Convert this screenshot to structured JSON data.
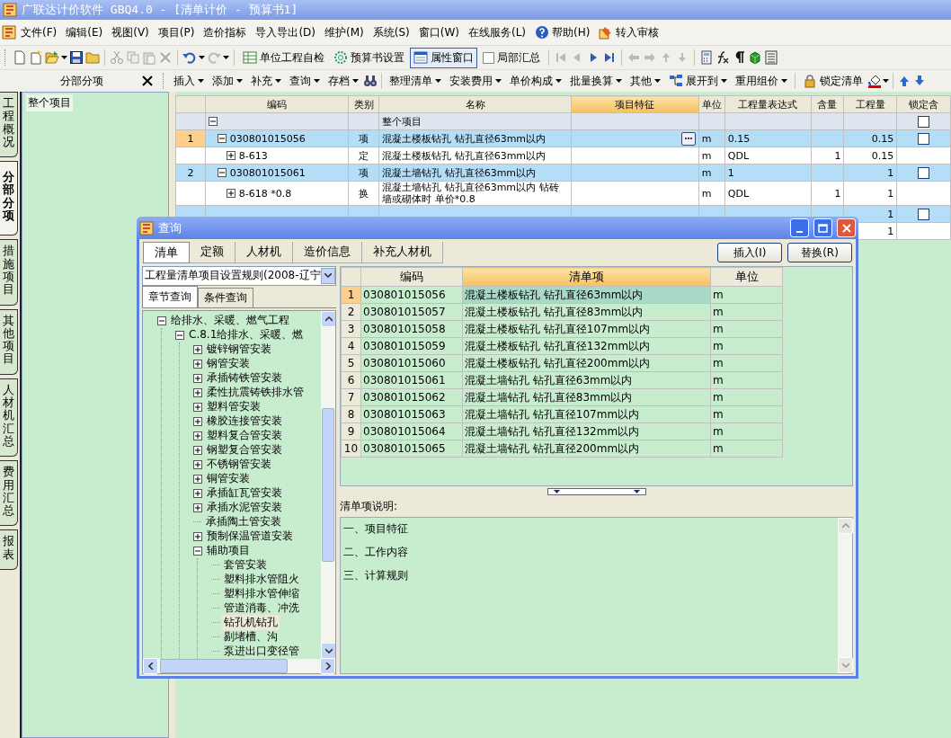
{
  "window": {
    "title": "广联达计价软件 GBQ4.0 - [清单计价 - 预算书1]"
  },
  "menu": [
    {
      "label": "文件(F)"
    },
    {
      "label": "编辑(E)"
    },
    {
      "label": "视图(V)"
    },
    {
      "label": "项目(P)"
    },
    {
      "label": "造价指标"
    },
    {
      "label": "导入导出(D)"
    },
    {
      "label": "维护(M)"
    },
    {
      "label": "系统(S)"
    },
    {
      "label": "窗口(W)"
    },
    {
      "label": "在线服务(L)"
    },
    {
      "label": "帮助(H)"
    },
    {
      "label": "转入审核"
    }
  ],
  "toolbar": [
    {
      "label": "单位工程自检",
      "kind": "button"
    },
    {
      "label": "预算书设置",
      "kind": "button"
    },
    {
      "label": "属性窗口",
      "kind": "toggle",
      "pressed": true
    },
    {
      "label": "局部汇总",
      "kind": "check",
      "checked": false
    }
  ],
  "side_tabs": [
    {
      "label": "工程概况",
      "selected": false
    },
    {
      "label": "分部分项",
      "selected": true
    },
    {
      "label": "措施项目",
      "selected": false
    },
    {
      "label": "其他项目",
      "selected": false
    },
    {
      "label": "人材机汇总",
      "selected": false
    },
    {
      "label": "费用汇总",
      "selected": false
    },
    {
      "label": "报表",
      "selected": false
    }
  ],
  "left_panel": {
    "title": "分部分项",
    "items": [
      {
        "label": "整个项目",
        "selected": true
      }
    ]
  },
  "grid_toolbar": [
    {
      "label": "插入",
      "dropdown": true
    },
    {
      "label": "添加",
      "dropdown": true
    },
    {
      "label": "补充",
      "dropdown": true
    },
    {
      "label": "查询",
      "dropdown": true
    },
    {
      "label": "存档",
      "dropdown": true
    },
    {
      "label": "整理清单",
      "dropdown": true
    },
    {
      "label": "安装费用",
      "dropdown": true
    },
    {
      "label": "单价构成",
      "dropdown": true
    },
    {
      "label": "批量换算",
      "dropdown": true
    },
    {
      "label": "其他",
      "dropdown": true
    },
    {
      "label": "展开到",
      "dropdown": true
    },
    {
      "label": "重用组价",
      "dropdown": true
    },
    {
      "label": "锁定清单",
      "dropdown": false
    }
  ],
  "table": {
    "columns": [
      {
        "label": "编码",
        "selected": false
      },
      {
        "label": "类别",
        "selected": false
      },
      {
        "label": "名称",
        "selected": false
      },
      {
        "label": "项目特征",
        "selected": true
      },
      {
        "label": "单位",
        "selected": false
      },
      {
        "label": "工程量表达式",
        "selected": false
      },
      {
        "label": "含量",
        "selected": false
      },
      {
        "label": "工程量",
        "selected": false
      },
      {
        "label": "锁定含",
        "selected": false
      }
    ],
    "rows": [
      {
        "kind": "section",
        "name": "整个项目",
        "expanded": true,
        "selected": false,
        "locked": false
      },
      {
        "kind": "bill",
        "seq": "1",
        "code": "030801015056",
        "type": "项",
        "name": "混凝土楼板钻孔 钻孔直径63mm以内",
        "unit": "m",
        "expr": "0.15",
        "qty": "0.15",
        "expanded": true,
        "selected": true,
        "locked": false
      },
      {
        "kind": "norm",
        "code": "8-613",
        "type": "定",
        "name": "混凝土楼板钻孔 钻孔直径63mm以内",
        "unit": "m",
        "expr": "QDL",
        "content": "1",
        "qty": "0.15",
        "expanded": false,
        "selected": false
      },
      {
        "kind": "bill",
        "seq": "2",
        "code": "030801015061",
        "type": "项",
        "name": "混凝土墙钻孔 钻孔直径63mm以内",
        "unit": "m",
        "expr": "1",
        "qty": "1",
        "expanded": true,
        "selected": false,
        "locked": false
      },
      {
        "kind": "norm",
        "code": "8-618 *0.8",
        "type": "换",
        "name": "混凝土墙钻孔 钻孔直径63mm以内 钻砖墙或砌体时 单价*0.8",
        "unit": "m",
        "expr": "QDL",
        "content": "1",
        "qty": "1",
        "expanded": false,
        "selected": false
      },
      {
        "kind": "bill",
        "qty": "1",
        "locked": false
      },
      {
        "kind": "norm",
        "qty": "1"
      }
    ]
  },
  "dialog": {
    "title": "查询",
    "tabs": [
      {
        "label": "清单",
        "selected": true
      },
      {
        "label": "定额",
        "selected": false
      },
      {
        "label": "人材机",
        "selected": false
      },
      {
        "label": "造价信息",
        "selected": false
      },
      {
        "label": "补充人材机",
        "selected": false
      }
    ],
    "buttons": [
      "插入(I)",
      "替换(R)"
    ],
    "rule_select": "工程量清单项目设置规则(2008-辽宁",
    "search_tabs": [
      {
        "label": "章节查询",
        "selected": true
      },
      {
        "label": "条件查询",
        "selected": false
      }
    ],
    "tree": [
      {
        "label": "给排水、采暖、燃气工程",
        "expanded": true,
        "selected": false,
        "children": [
          {
            "label": "C.8.1给排水、采暖、燃",
            "expanded": true,
            "selected": false,
            "children": [
              {
                "label": "镀锌钢管安装",
                "expanded": false,
                "selected": false
              },
              {
                "label": "钢管安装",
                "expanded": false,
                "selected": false
              },
              {
                "label": "承插铸铁管安装",
                "expanded": false,
                "selected": false
              },
              {
                "label": "柔性抗震铸铁排水管",
                "expanded": false,
                "selected": false
              },
              {
                "label": "塑料管安装",
                "expanded": false,
                "selected": false
              },
              {
                "label": "橡胶连接管安装",
                "expanded": false,
                "selected": false
              },
              {
                "label": "塑料复合管安装",
                "expanded": false,
                "selected": false
              },
              {
                "label": "钢塑复合管安装",
                "expanded": false,
                "selected": false
              },
              {
                "label": "不锈钢管安装",
                "expanded": false,
                "selected": false
              },
              {
                "label": "铜管安装",
                "expanded": false,
                "selected": false
              },
              {
                "label": "承插缸瓦管安装",
                "expanded": false,
                "selected": false
              },
              {
                "label": "承插水泥管安装",
                "expanded": false,
                "selected": false
              },
              {
                "label": "承插陶土管安装",
                "selected": false
              },
              {
                "label": "预制保温管道安装",
                "expanded": false,
                "selected": false
              },
              {
                "label": "辅助项目",
                "expanded": true,
                "selected": false,
                "children": [
                  {
                    "label": "套管安装",
                    "selected": false
                  },
                  {
                    "label": "塑料排水管阻火",
                    "selected": false
                  },
                  {
                    "label": "塑料排水管伸缩",
                    "selected": false
                  },
                  {
                    "label": "管道消毒、冲洗",
                    "selected": false
                  },
                  {
                    "label": "钻孔机钻孔",
                    "selected": true
                  },
                  {
                    "label": "剔堵槽、沟",
                    "selected": false
                  },
                  {
                    "label": "泵进出口变径管",
                    "selected": false
                  }
                ]
              }
            ]
          }
        ]
      }
    ],
    "columns": [
      {
        "label": "编码",
        "selected": false
      },
      {
        "label": "清单项",
        "selected": true
      },
      {
        "label": "单位",
        "selected": false
      }
    ],
    "rows": [
      {
        "num": "1",
        "code": "030801015056",
        "name": "混凝土楼板钻孔 钻孔直径63mm以内",
        "unit": "m",
        "selected": true
      },
      {
        "num": "2",
        "code": "030801015057",
        "name": "混凝土楼板钻孔 钻孔直径83mm以内",
        "unit": "m",
        "selected": false
      },
      {
        "num": "3",
        "code": "030801015058",
        "name": "混凝土楼板钻孔 钻孔直径107mm以内",
        "unit": "m",
        "selected": false
      },
      {
        "num": "4",
        "code": "030801015059",
        "name": "混凝土楼板钻孔 钻孔直径132mm以内",
        "unit": "m",
        "selected": false
      },
      {
        "num": "5",
        "code": "030801015060",
        "name": "混凝土楼板钻孔 钻孔直径200mm以内",
        "unit": "m",
        "selected": false
      },
      {
        "num": "6",
        "code": "030801015061",
        "name": "混凝土墙钻孔 钻孔直径63mm以内",
        "unit": "m",
        "selected": false
      },
      {
        "num": "7",
        "code": "030801015062",
        "name": "混凝土墙钻孔 钻孔直径83mm以内",
        "unit": "m",
        "selected": false
      },
      {
        "num": "8",
        "code": "030801015063",
        "name": "混凝土墙钻孔 钻孔直径107mm以内",
        "unit": "m",
        "selected": false
      },
      {
        "num": "9",
        "code": "030801015064",
        "name": "混凝土墙钻孔 钻孔直径132mm以内",
        "unit": "m",
        "selected": false
      },
      {
        "num": "10",
        "code": "030801015065",
        "name": "混凝土墙钻孔 钻孔直径200mm以内",
        "unit": "m",
        "selected": false
      }
    ],
    "description": {
      "label": "清单项说明:",
      "lines": [
        "一、项目特征",
        "二、工作内容",
        "三、计算规则"
      ]
    }
  }
}
